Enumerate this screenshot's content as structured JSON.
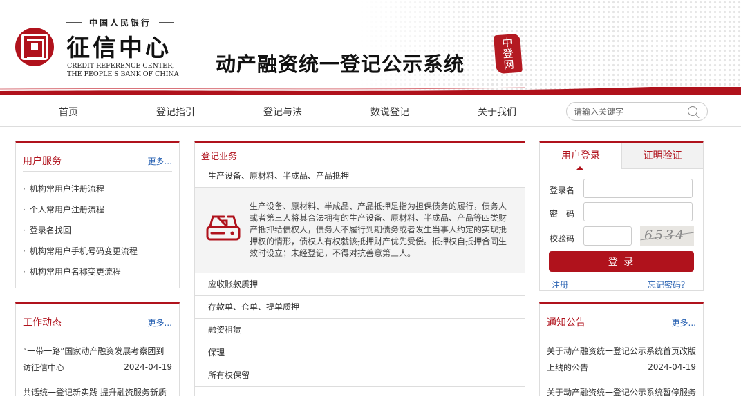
{
  "header": {
    "pboc_label": "中国人民银行",
    "logo_cn": "征信中心",
    "logo_en_line1": "CREDIT REFERENCE CENTER,",
    "logo_en_line2": "THE PEOPLE'S BANK OF CHINA",
    "system_title": "动产融资统一登记公示系统",
    "seal_line1": "中",
    "seal_line2": "登",
    "seal_line3": "网",
    "accent_color": "#b0121c"
  },
  "nav": {
    "items": [
      "首页",
      "登记指引",
      "登记与法",
      "数说登记",
      "关于我们"
    ],
    "search_placeholder": "请输入关键字"
  },
  "user_service": {
    "title": "用户服务",
    "more": "更多...",
    "items": [
      "机构常用户注册流程",
      "个人常用户注册流程",
      "登录名找回",
      "机构常用户手机号码变更流程",
      "机构常用户名称变更流程"
    ]
  },
  "work_news": {
    "title": "工作动态",
    "more": "更多...",
    "items": [
      {
        "text": "“一带一路”国家动产融资发展考察团到访征信中心",
        "date": "2024-04-19"
      },
      {
        "text": "共话统一登记新实践 提升融资服务新质",
        "date": ""
      }
    ]
  },
  "business": {
    "title": "登记业务",
    "rows": [
      "生产设备、原材料、半成品、产品抵押",
      "应收账款质押",
      "存款单、仓单、提单质押",
      "融资租赁",
      "保理",
      "所有权保留"
    ],
    "detail": "生产设备、原材料、半成品、产品抵押是指为担保债务的履行，债务人或者第三人将其合法拥有的生产设备、原材料、半成品、产品等四类财产抵押给债权人，债务人不履行到期债务或者发生当事人约定的实现抵押权的情形，债权人有权就该抵押财产优先受偿。抵押权自抵押合同生效时设立；未经登记，不得对抗善意第三人。"
  },
  "login": {
    "tab_login": "用户登录",
    "tab_verify": "证明验证",
    "username_label": "登录名",
    "password_label": "密　码",
    "captcha_label": "校验码",
    "captcha_text": "6534",
    "login_button": "登 录",
    "register": "注册",
    "forgot": "忘记密码？"
  },
  "notice": {
    "title": "通知公告",
    "more": "更多...",
    "items": [
      {
        "text": "关于动产融资统一登记公示系统首页改版上线的公告",
        "date": "2024-04-19"
      },
      {
        "text": "关于动产融资统一登记公示系统暂停服务",
        "date": ""
      }
    ]
  }
}
